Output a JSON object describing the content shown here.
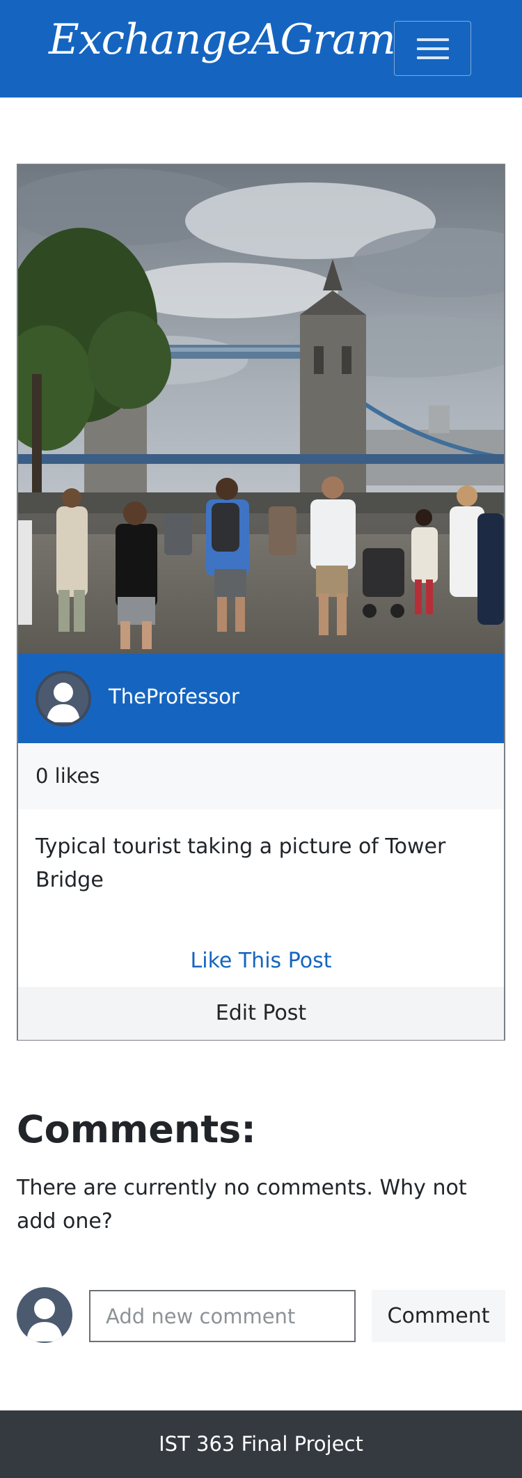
{
  "navbar": {
    "brand": "ExchangeAGram",
    "toggle_icon": "hamburger-icon",
    "color": "#1565c0"
  },
  "post": {
    "image_alt": "Tower Bridge",
    "author": "TheProfessor",
    "avatar_icon": "user-avatar-icon",
    "likes_text": "0 likes",
    "caption": "Typical tourist taking a picture of Tower Bridge",
    "like_label": "Like This Post",
    "edit_label": "Edit Post"
  },
  "comments": {
    "heading": "Comments:",
    "empty_text": "There are currently no comments. Why not add one?",
    "input_placeholder": "Add new comment",
    "input_value": "",
    "submit_label": "Comment"
  },
  "footer": {
    "text": "IST 363 Final Project"
  }
}
